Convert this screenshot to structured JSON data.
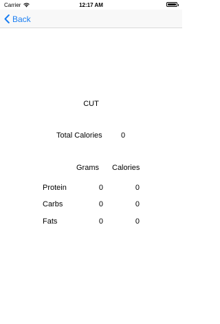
{
  "status_bar": {
    "carrier": "Carrier",
    "time": "12:17 AM",
    "wifi_icon": "wifi-icon",
    "battery_icon": "battery-icon"
  },
  "nav": {
    "back_label": "Back",
    "back_icon": "chevron-left-icon",
    "accent_color": "#1a7ef2"
  },
  "plan": {
    "title": "CUT",
    "total_calories_label": "Total Calories",
    "total_calories_value": "0"
  },
  "macros": {
    "headers": {
      "grams": "Grams",
      "calories": "Calories"
    },
    "rows": [
      {
        "label": "Protein",
        "grams": "0",
        "calories": "0"
      },
      {
        "label": "Carbs",
        "grams": "0",
        "calories": "0"
      },
      {
        "label": "Fats",
        "grams": "0",
        "calories": "0"
      }
    ]
  }
}
